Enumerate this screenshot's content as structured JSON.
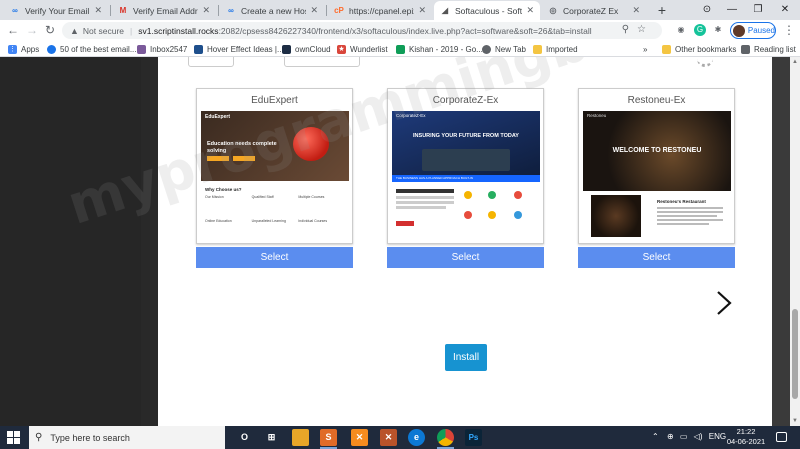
{
  "browser": {
    "tabs": [
      {
        "title": "Verify Your Email Addre",
        "icon": "infinity-icon",
        "icon_color": "#1a73e8",
        "active": false
      },
      {
        "title": "Verify Email Address -",
        "icon": "gmail-icon",
        "icon_color": "#d93025",
        "active": false
      },
      {
        "title": "Create a new Hosting",
        "icon": "infinity-icon",
        "icon_color": "#1a73e8",
        "active": false
      },
      {
        "title": "https://cpanel.epizy.co",
        "icon": "cpanel-icon",
        "icon_color": "#ff6c2c",
        "active": false
      },
      {
        "title": "Softaculous - Softacul",
        "icon": "softaculous-icon",
        "icon_color": "#555555",
        "active": true
      },
      {
        "title": "CorporateZ Ex",
        "icon": "globe-icon",
        "icon_color": "#5f6368",
        "active": false
      }
    ],
    "address": {
      "security_label": "Not secure",
      "url_host": "sv1.scriptinstall.rocks",
      "url_rest": ":2082/cpsess8426227340/frontend/x3/softaculous/index.live.php?act=software&soft=26&tab=install"
    },
    "profile_label": "Paused",
    "bookmarks": [
      {
        "label": "Apps",
        "icon": "apps-grid-icon",
        "color": "#4285f4"
      },
      {
        "label": "50 of the best email...",
        "icon": "chrome-icon",
        "color": "#1a73e8"
      },
      {
        "label": "Inbox2547",
        "icon": "inbox-icon",
        "color": "#7b5a9a"
      },
      {
        "label": "Hover Effect Ideas |...",
        "icon": "codrops-icon",
        "color": "#1e4f8c"
      },
      {
        "label": "ownCloud",
        "icon": "cloud-icon",
        "color": "#1d2d44"
      },
      {
        "label": "Wunderlist",
        "icon": "star-icon",
        "color": "#d9463b"
      },
      {
        "label": "Kishan - 2019 - Go...",
        "icon": "sheets-icon",
        "color": "#0f9d58"
      },
      {
        "label": "New Tab",
        "icon": "globe-icon",
        "color": "#5f6368"
      },
      {
        "label": "Imported",
        "icon": "folder-icon",
        "color": "#f4c542"
      }
    ],
    "bookmarks_right": [
      {
        "label": "Other bookmarks",
        "icon": "folder-icon"
      },
      {
        "label": "Reading list",
        "icon": "reading-list-icon"
      }
    ],
    "overflow_label": "»"
  },
  "page": {
    "themes": [
      {
        "title": "EduExpert",
        "select_label": "Select",
        "preview": {
          "brand": "EduExpert",
          "headline": "Education needs complete solving",
          "section": "Why Choose us?",
          "features": [
            "Our Mission",
            "Qualified Staff",
            "Multiple Courses",
            "Online Education",
            "Unparalleled Learning",
            "Individual Courses"
          ]
        }
      },
      {
        "title": "CorporateZ-Ex",
        "select_label": "Select",
        "preview": {
          "brand": "CorporateZ-Ex",
          "headline": "INSURING YOUR FUTURE FROM TODAY",
          "strip": "THE BUSINESS HAS A PLANNED APPROACH BUILT-IN"
        }
      },
      {
        "title": "Restoneu-Ex",
        "select_label": "Select",
        "preview": {
          "brand": "Restoneu",
          "headline": "WELCOME TO RESTONEU",
          "subhead": "Restoneu's Restaurant"
        }
      }
    ],
    "install_label": "Install",
    "watermark": "myprogrammingbook"
  },
  "taskbar": {
    "search_placeholder": "Type here to search",
    "apps": [
      {
        "name": "task-view-icon",
        "glyph": "O",
        "color": "#1f2a3c"
      },
      {
        "name": "widgets-icon",
        "glyph": "⊞",
        "color": "#1f2a3c"
      },
      {
        "name": "file-explorer-icon",
        "glyph": "▬",
        "color": "#e8a628"
      },
      {
        "name": "sublime-icon",
        "glyph": "S",
        "color": "#e06b27"
      },
      {
        "name": "xampp-icon",
        "glyph": "✕",
        "color": "#f68c1f"
      },
      {
        "name": "edge-icon",
        "glyph": "e",
        "color": "#0c78d4"
      },
      {
        "name": "chrome-icon",
        "glyph": "●",
        "color": "#dd4b39"
      },
      {
        "name": "photoshop-icon",
        "glyph": "Ps",
        "color": "#0b2438"
      }
    ],
    "tray_language": "ENG",
    "time": "21:22",
    "date": "04-06-2021"
  }
}
